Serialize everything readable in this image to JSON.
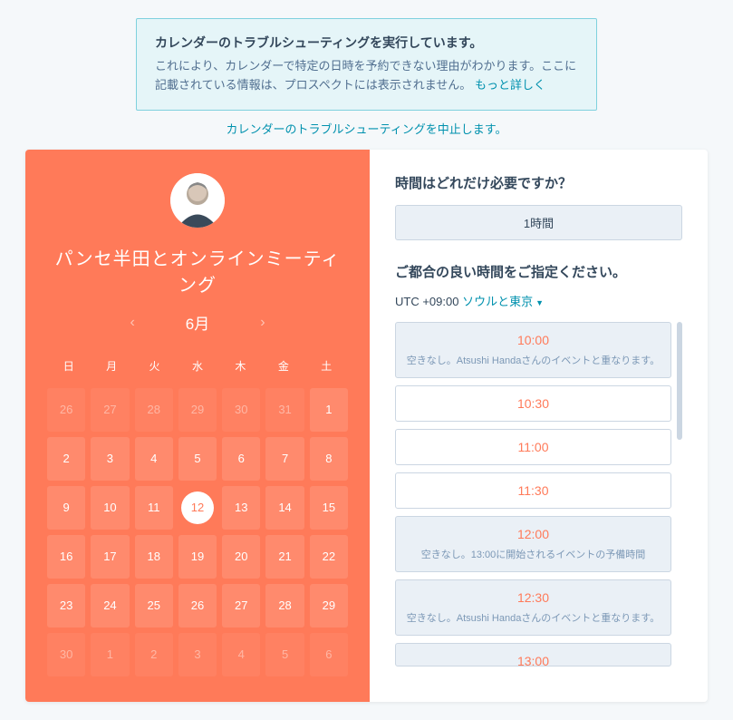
{
  "notice": {
    "title": "カレンダーのトラブルシューティングを実行しています。",
    "body": "これにより、カレンダーで特定の日時を予約できない理由がわかります。ここに記載されている情報は、プロスペクトには表示されません。",
    "link": "もっと詳しく"
  },
  "stopLink": "カレンダーのトラブルシューティングを中止します。",
  "meeting": {
    "title": "パンセ半田とオンラインミーティング",
    "month": "6月",
    "dow": [
      "日",
      "月",
      "火",
      "水",
      "木",
      "金",
      "土"
    ],
    "days": [
      {
        "n": "26",
        "out": true
      },
      {
        "n": "27",
        "out": true
      },
      {
        "n": "28",
        "out": true
      },
      {
        "n": "29",
        "out": true
      },
      {
        "n": "30",
        "out": true
      },
      {
        "n": "31",
        "out": true
      },
      {
        "n": "1"
      },
      {
        "n": "2"
      },
      {
        "n": "3"
      },
      {
        "n": "4"
      },
      {
        "n": "5"
      },
      {
        "n": "6"
      },
      {
        "n": "7"
      },
      {
        "n": "8"
      },
      {
        "n": "9"
      },
      {
        "n": "10"
      },
      {
        "n": "11"
      },
      {
        "n": "12",
        "sel": true
      },
      {
        "n": "13"
      },
      {
        "n": "14"
      },
      {
        "n": "15"
      },
      {
        "n": "16"
      },
      {
        "n": "17"
      },
      {
        "n": "18"
      },
      {
        "n": "19"
      },
      {
        "n": "20"
      },
      {
        "n": "21"
      },
      {
        "n": "22"
      },
      {
        "n": "23"
      },
      {
        "n": "24"
      },
      {
        "n": "25"
      },
      {
        "n": "26"
      },
      {
        "n": "27"
      },
      {
        "n": "28"
      },
      {
        "n": "29"
      },
      {
        "n": "30",
        "out": true
      },
      {
        "n": "1",
        "out": true
      },
      {
        "n": "2",
        "out": true
      },
      {
        "n": "3",
        "out": true
      },
      {
        "n": "4",
        "out": true
      },
      {
        "n": "5",
        "out": true
      },
      {
        "n": "6",
        "out": true
      }
    ]
  },
  "timePanel": {
    "q1": "時間はどれだけ必要ですか？",
    "duration": "1時間",
    "q2": "ご都合の良い時間をご指定ください。",
    "tzOffset": "UTC +09:00",
    "tzLabel": "ソウルと東京",
    "slots": [
      {
        "time": "10:00",
        "busy": true,
        "reason": "空きなし。Atsushi Handaさんのイベントと重なります。"
      },
      {
        "time": "10:30"
      },
      {
        "time": "11:00"
      },
      {
        "time": "11:30"
      },
      {
        "time": "12:00",
        "busy": true,
        "reason": "空きなし。13:00に開始されるイベントの予備時間"
      },
      {
        "time": "12:30",
        "busy": true,
        "reason": "空きなし。Atsushi Handaさんのイベントと重なります。"
      },
      {
        "time": "13:00",
        "busy": true,
        "cut": true
      }
    ]
  }
}
